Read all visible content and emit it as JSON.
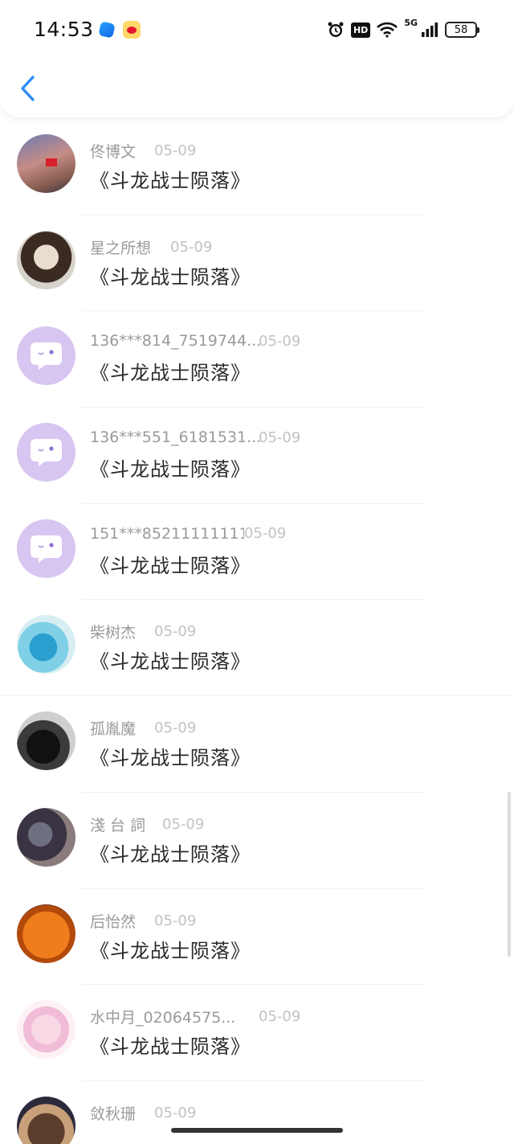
{
  "status_bar": {
    "time": "14:53",
    "network_label": "5G",
    "hd_label": "HD",
    "battery": "58"
  },
  "items": [
    {
      "name": "佟博文",
      "date": "05-09",
      "title": "《斗龙战士陨落》"
    },
    {
      "name": "星之所想",
      "date": "05-09",
      "title": "《斗龙战士陨落》"
    },
    {
      "name": "136***814_7519744...",
      "date": "05-09",
      "title": "《斗龙战士陨落》"
    },
    {
      "name": "136***551_6181531...",
      "date": "05-09",
      "title": "《斗龙战士陨落》"
    },
    {
      "name": "151***85211111111111",
      "date": "05-09",
      "title": "《斗龙战士陨落》"
    },
    {
      "name": "柴树杰",
      "date": "05-09",
      "title": "《斗龙战士陨落》"
    },
    {
      "name": "孤胤魔",
      "date": "05-09",
      "title": "《斗龙战士陨落》"
    },
    {
      "name": "淺 台 詞",
      "date": "05-09",
      "title": "《斗龙战士陨落》"
    },
    {
      "name": "后怡然",
      "date": "05-09",
      "title": "《斗龙战士陨落》"
    },
    {
      "name": "水中月_02064575...",
      "date": "05-09",
      "title": "《斗龙战士陨落》"
    },
    {
      "name": "敛秋珊",
      "date": "05-09",
      "title": ""
    }
  ]
}
